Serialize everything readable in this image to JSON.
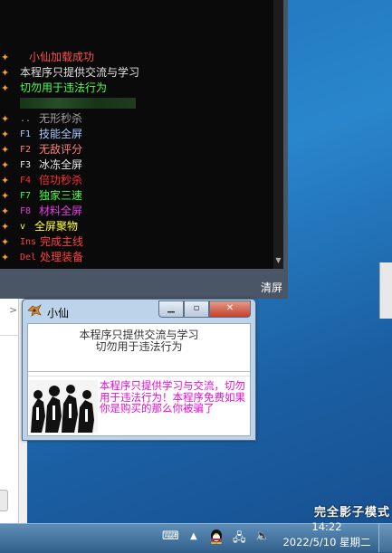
{
  "console": {
    "clear_label": "清屏",
    "lines": [
      {
        "prefix": "",
        "text": "小仙加载成功",
        "color": "#ff5050"
      },
      {
        "prefix": "",
        "text": "本程序只提供交流与学习",
        "color": "#e0e0e0"
      },
      {
        "prefix": "",
        "text": "切勿用于违法行为",
        "color": "#50ff50"
      },
      {
        "prefix": "..",
        "text": "无形秒杀",
        "color": "#a0a0a0"
      },
      {
        "prefix": "F1",
        "text": "技能全屏",
        "color": "#a8c8ff"
      },
      {
        "prefix": "F2",
        "text": "无敌评分",
        "color": "#ff8080"
      },
      {
        "prefix": "F3",
        "text": "冰冻全屏",
        "color": "#e8e8e8"
      },
      {
        "prefix": "F4",
        "text": "倍功秒杀",
        "color": "#ff3030"
      },
      {
        "prefix": "F7",
        "text": "独家三速",
        "color": "#40ff40"
      },
      {
        "prefix": "F8",
        "text": "材料全屏",
        "color": "#e040e0"
      },
      {
        "prefix": "v",
        "text": "全屏聚物",
        "color": "#ffff40"
      },
      {
        "prefix": "Ins",
        "text": "完成主线",
        "color": "#ff4040"
      },
      {
        "prefix": "Del",
        "text": "处理装备",
        "color": "#ff4040"
      }
    ],
    "prefix_colors": {
      "..": "#a0a0a0",
      "F1": "#a8c8ff",
      "F2": "#ff8080",
      "F3": "#e8e8e8",
      "F4": "#ff3030",
      "F7": "#40ff40",
      "F8": "#e040e0",
      "v": "#ffff40",
      "Ins": "#ff4040",
      "Del": "#ff4040"
    }
  },
  "window": {
    "title": "小仙",
    "notice_line1": "本程序只提供交流与学习",
    "notice_line2": "切勿用于违法行为",
    "disclaimer": "本程序只提供学习与交流，切勿用于违法行为！本程序免费如果你是购买的那么你被骗了"
  },
  "desktop": {
    "mode_text": "完全影子模式"
  },
  "taskbar": {
    "time": "14:22",
    "date": "2022/5/10 星期二"
  }
}
